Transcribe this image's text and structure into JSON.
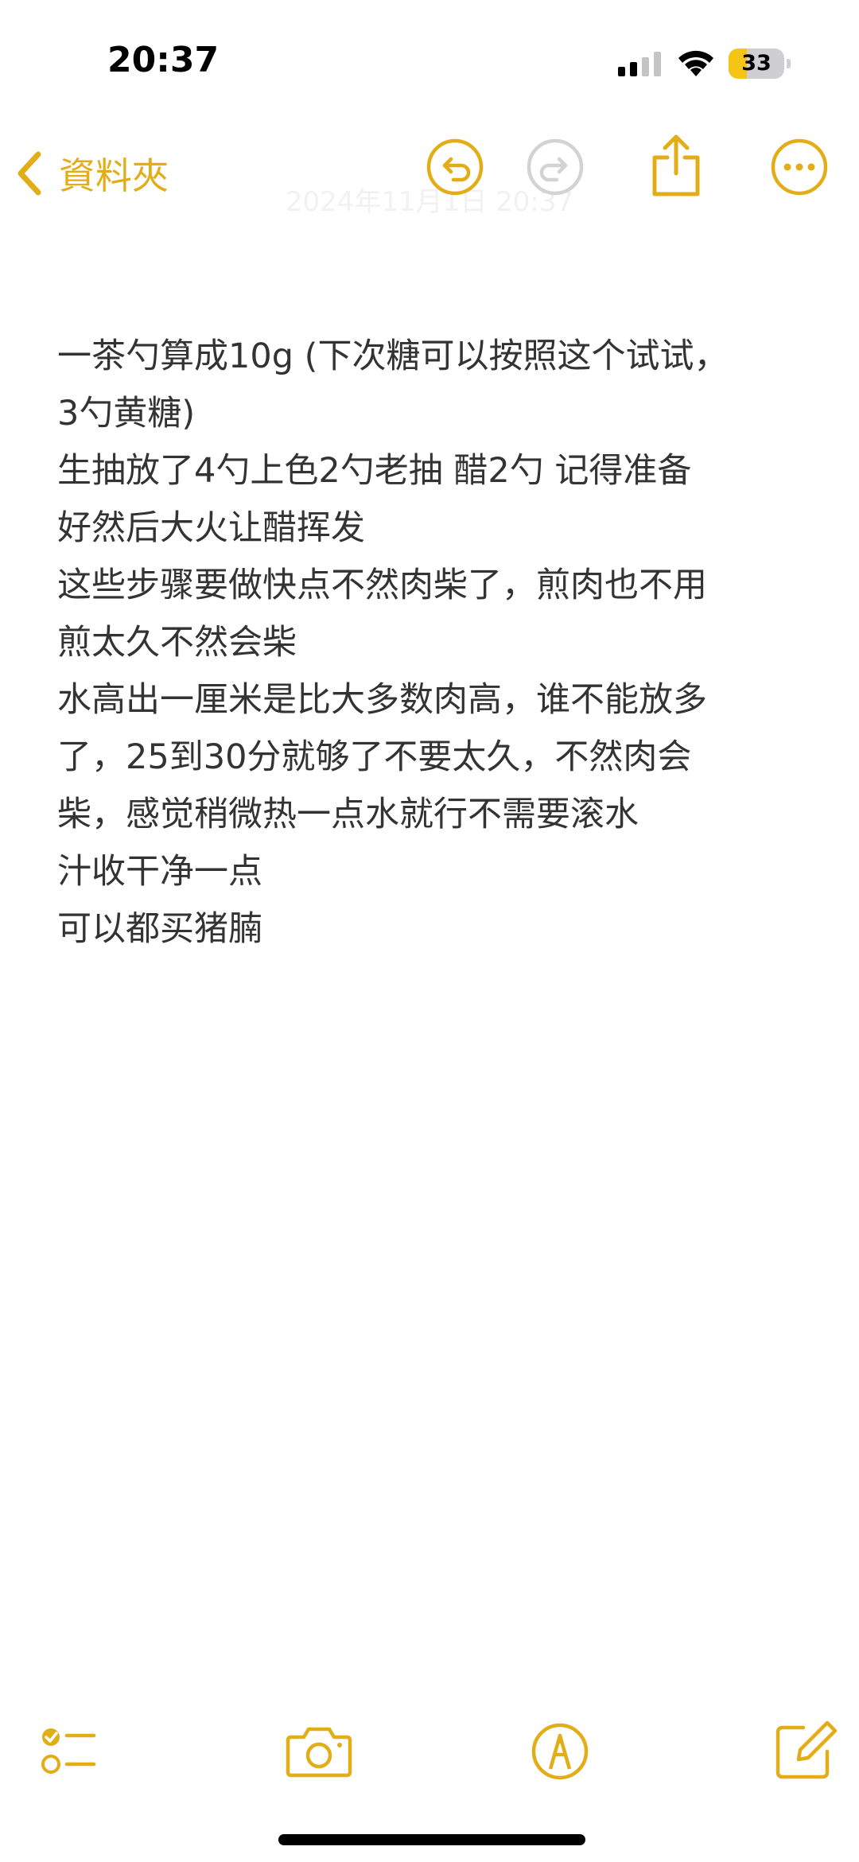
{
  "status_bar": {
    "time": "20:37",
    "battery_level": "33",
    "battery_fraction": 0.33,
    "signal_icon": "cellular-signal-icon",
    "wifi_icon": "wifi-icon"
  },
  "nav": {
    "back_label": "資料夾",
    "back_icon": "chevron-left-icon",
    "undo_icon": "undo-icon",
    "redo_icon": "redo-icon",
    "share_icon": "share-icon",
    "more_icon": "more-icon",
    "accent_color": "#E3AD17"
  },
  "note": {
    "date": "2024年11月1日 20:37",
    "lines": [
      "一茶勺算成10g (下次糖可以按照这个试试，",
      "3勺黄糖)",
      "生抽放了4勺上色2勺老抽 醋2勺 记得准备",
      "好然后大火让醋挥发",
      "这些步骤要做快点不然肉柴了，煎肉也不用",
      "煎太久不然会柴",
      "水高出一厘米是比大多数肉高，谁不能放多",
      "了，25到30分就够了不要太久，不然肉会",
      "柴，感觉稍微热一点水就行不需要滚水",
      "汁收干净一点",
      "可以都买猪腩"
    ]
  },
  "toolbar": {
    "checklist_icon": "checklist-icon",
    "camera_icon": "camera-icon",
    "markup_icon": "markup-pen-icon",
    "compose_icon": "compose-icon"
  }
}
